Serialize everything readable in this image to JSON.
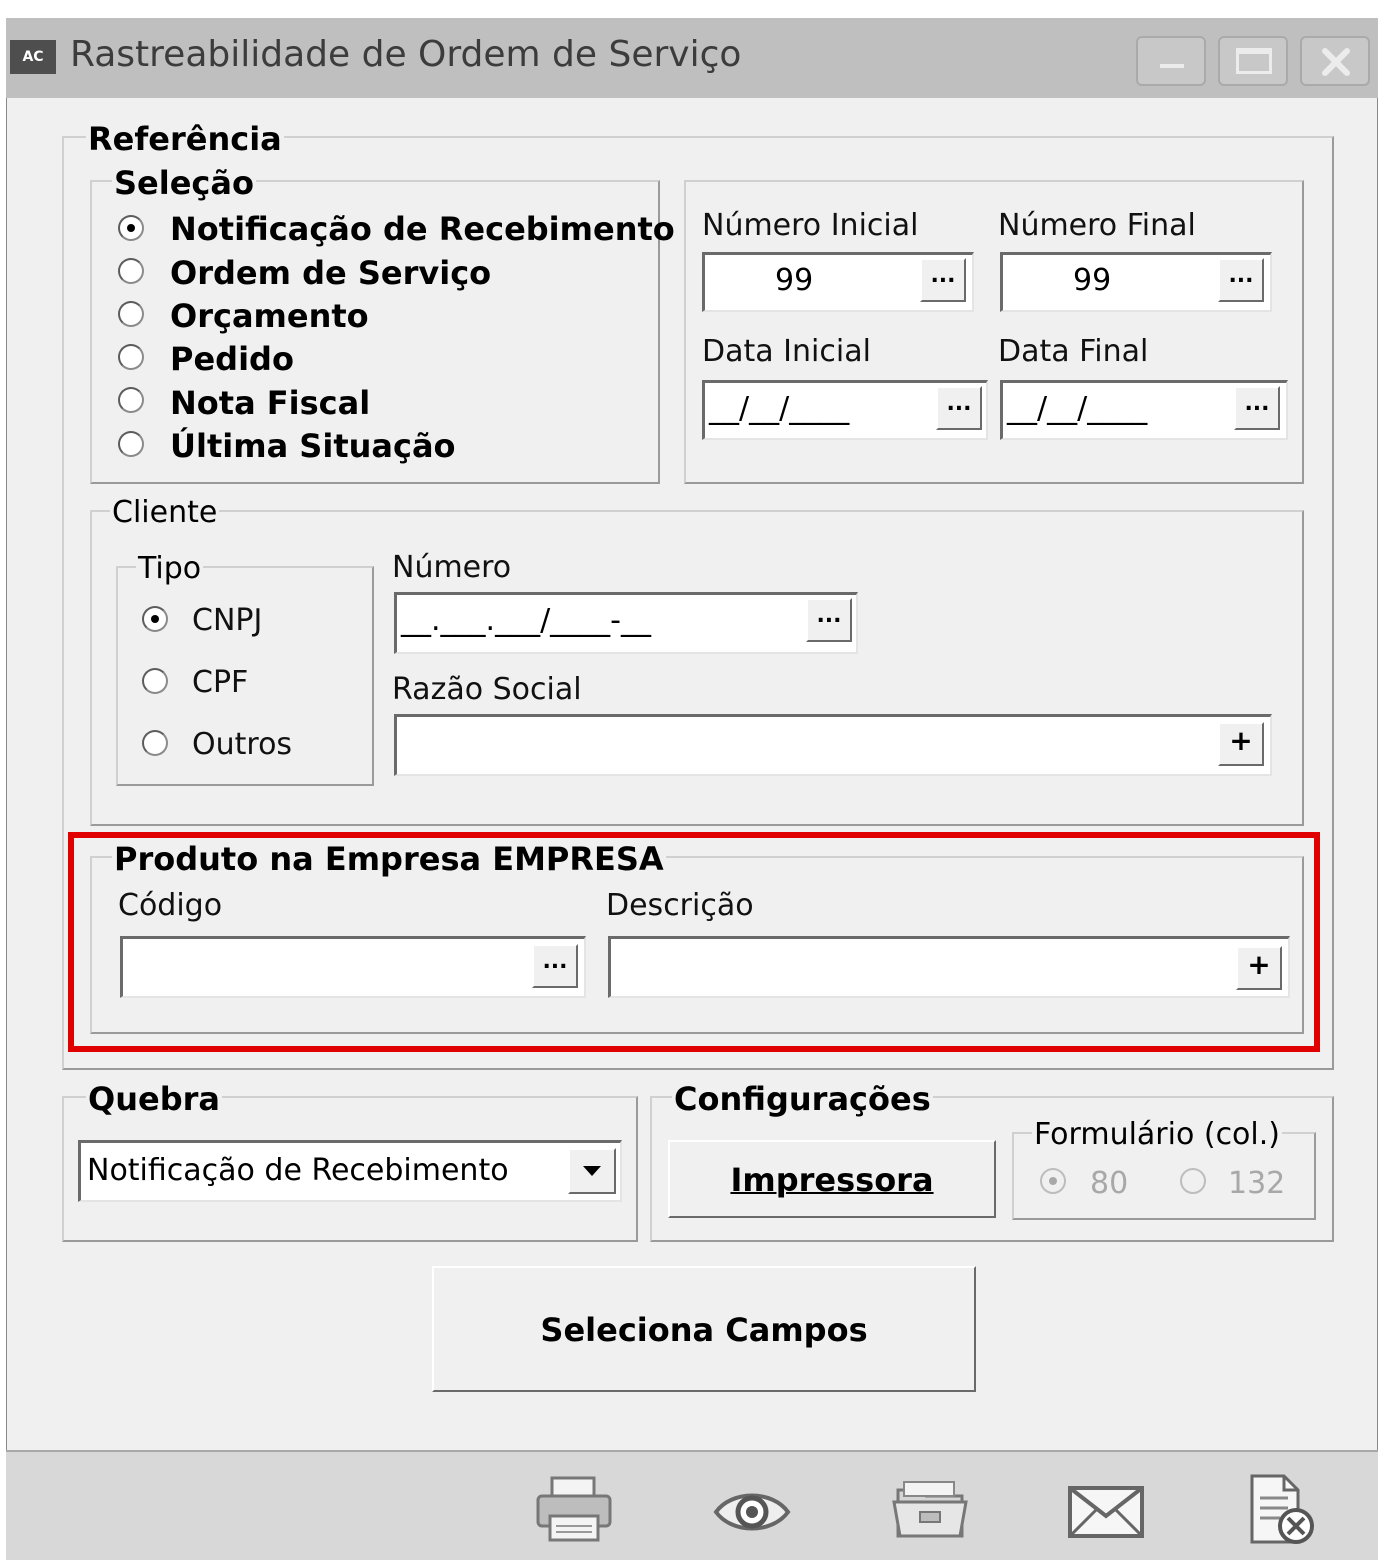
{
  "window": {
    "app_icon": "AC",
    "title": "Rastreabilidade de Ordem de Serviço"
  },
  "referencia": {
    "legend": "Referência",
    "selecao": {
      "legend": "Seleção",
      "options": [
        "Notificação de Recebimento",
        "Ordem de Serviço",
        "Orçamento",
        "Pedido",
        "Nota Fiscal",
        "Última Situação"
      ],
      "selected": "Notificação de Recebimento"
    },
    "numero_inicial": {
      "label": "Número Inicial",
      "value": "99"
    },
    "numero_final": {
      "label": "Número Final",
      "value": "99"
    },
    "data_inicial": {
      "label": "Data Inicial",
      "value": "__/__/____"
    },
    "data_final": {
      "label": "Data Final",
      "value": "__/__/____"
    }
  },
  "cliente": {
    "legend": "Cliente",
    "tipo": {
      "legend": "Tipo",
      "options": [
        "CNPJ",
        "CPF",
        "Outros"
      ],
      "selected": "CNPJ"
    },
    "numero": {
      "label": "Número",
      "value": "__.___.___/____-__"
    },
    "razao_social": {
      "label": "Razão Social",
      "value": ""
    }
  },
  "produto": {
    "legend": "Produto na Empresa EMPRESA",
    "codigo": {
      "label": "Código",
      "value": ""
    },
    "descricao": {
      "label": "Descrição",
      "value": ""
    }
  },
  "quebra": {
    "legend": "Quebra",
    "selected": "Notificação de Recebimento"
  },
  "configuracoes": {
    "legend": "Configurações",
    "impressora_label": "Impressora",
    "formulario": {
      "legend": "Formulário (col.)",
      "options": [
        "80",
        "132"
      ],
      "selected": "80"
    }
  },
  "seleciona_campos_label": "Seleciona Campos",
  "buttons": {
    "ellipsis": "...",
    "plus": "+"
  },
  "toolbar_icons": [
    "printer-icon",
    "eye-icon",
    "folder-icon",
    "envelope-icon",
    "document-close-icon"
  ],
  "colors": {
    "highlight": "#e00000",
    "titlebar": "#bfbfbf",
    "window": "#f0f0f0"
  }
}
